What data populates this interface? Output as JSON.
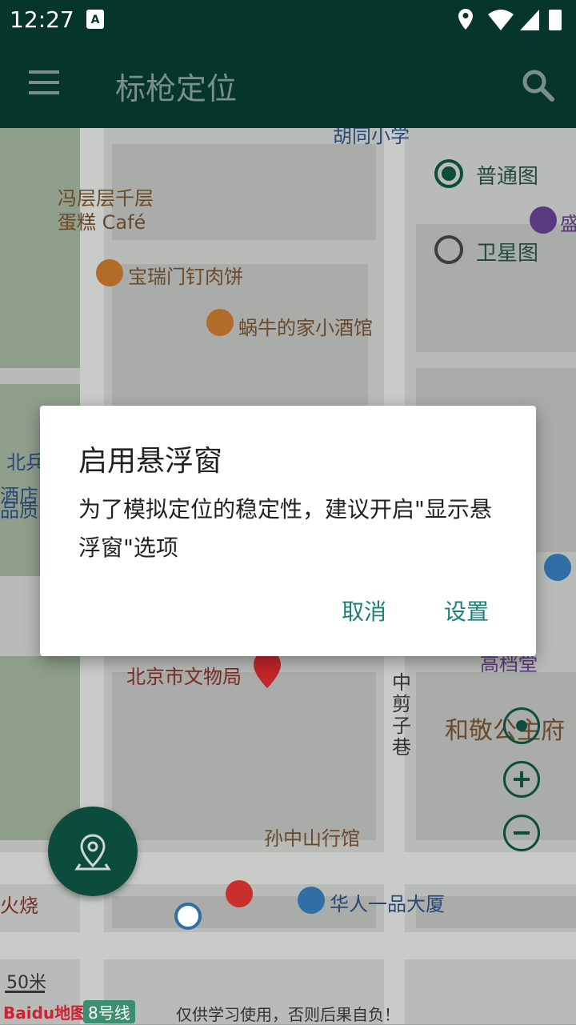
{
  "status_bar": {
    "time": "12:27",
    "notification_glyph": "A"
  },
  "app_bar": {
    "title": "标枪定位",
    "menu_icon": "hamburger-menu-icon",
    "search_icon": "search-icon"
  },
  "map_type": {
    "options": [
      {
        "label": "普通图",
        "selected": true
      },
      {
        "label": "卫星图",
        "selected": false
      }
    ]
  },
  "map_labels": {
    "poi_1": "胡同小学",
    "poi_2_line1": "冯层层千层",
    "poi_2_line2": "蛋糕 Café",
    "poi_3": "宝瑞门钉肉饼",
    "poi_4": "蜗牛的家小酒馆",
    "poi_5": "北京市文物局",
    "street_vertical": "中剪子巷",
    "poi_6": "和敬公主府",
    "poi_7": "孙中山行馆",
    "poi_8": "华人一品大厦",
    "poi_9": "高档堂",
    "edge_left_1": "北兵",
    "edge_left_2": "酒店",
    "edge_left_3": "品质酒",
    "edge_left_4": "火烧",
    "edge_right_1": "盛"
  },
  "scale": {
    "label": "50米"
  },
  "footer": {
    "logo": "Baidu地图",
    "metro": "8号线",
    "disclaimer": "仅供学习使用，否则后果自负！"
  },
  "dialog": {
    "title": "启用悬浮窗",
    "message": "为了模拟定位的稳定性，建议开启\"显示悬浮窗\"选项",
    "cancel": "取消",
    "settings": "设置"
  },
  "colors": {
    "primary_dark": "#06362b",
    "accent": "#1b8078"
  }
}
